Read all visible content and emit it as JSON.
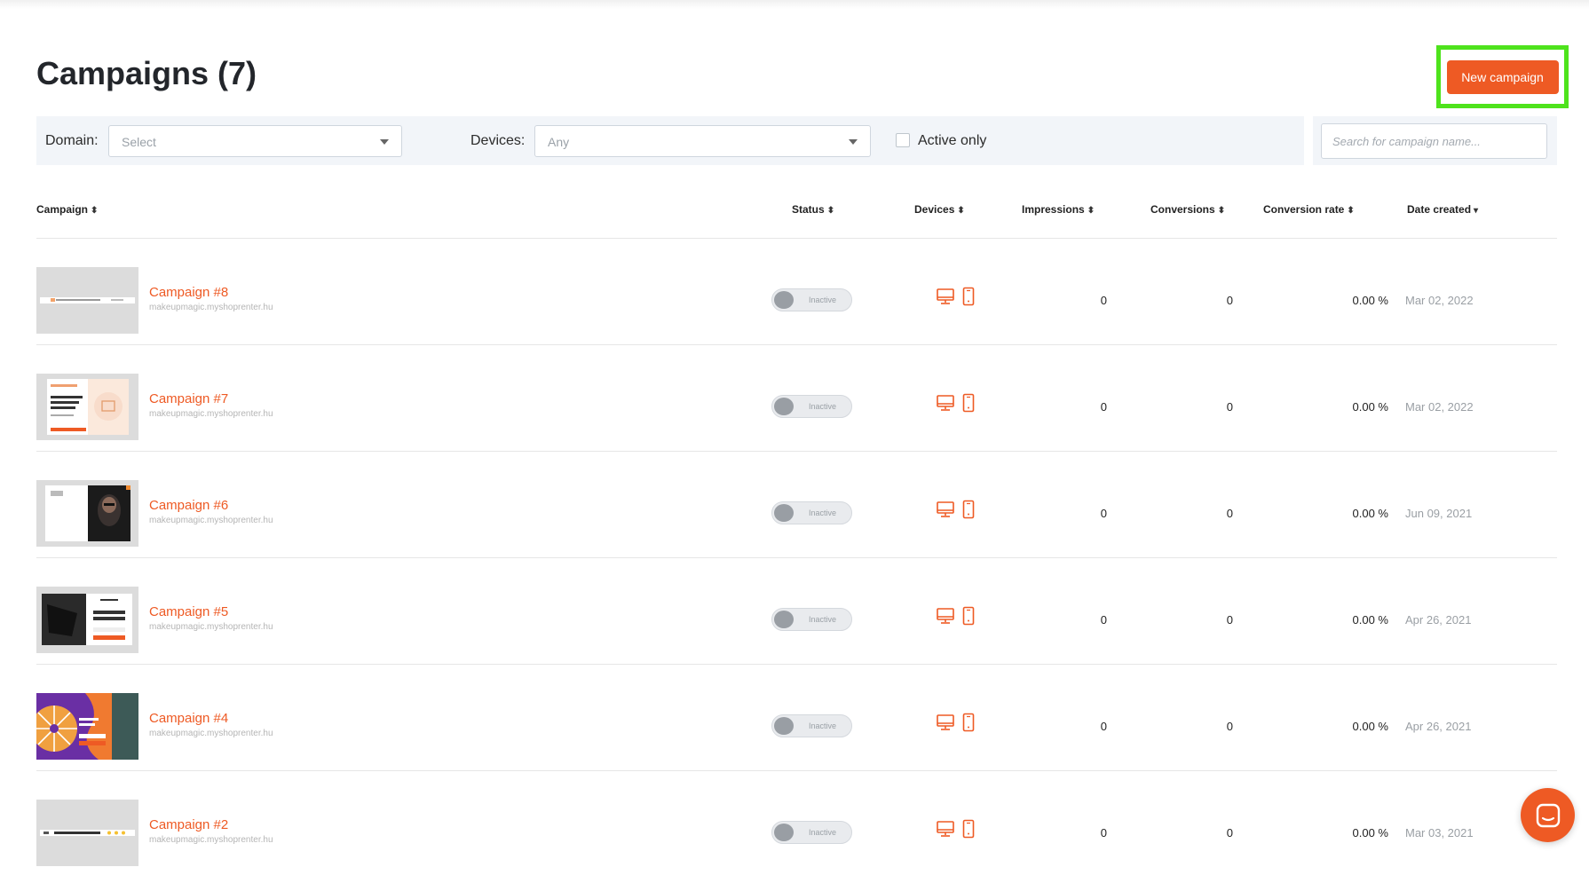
{
  "page": {
    "title": "Campaigns (7)",
    "new_campaign_label": "New campaign",
    "accent_color": "#ee5a24"
  },
  "filters": {
    "domain_label": "Domain:",
    "domain_value": "Select",
    "devices_label": "Devices:",
    "devices_value": "Any",
    "active_only_label": "Active only",
    "active_only_checked": false,
    "search_placeholder": "Search for campaign name..."
  },
  "table": {
    "columns": [
      "Campaign",
      "Status",
      "Devices",
      "Impressions",
      "Conversions",
      "Conversion rate",
      "Date created"
    ],
    "sorted_column": "Date created",
    "rows": [
      {
        "name": "Campaign #8",
        "domain": "makeupmagic.myshoprenter.hu",
        "status": "Inactive",
        "devices": [
          "desktop-icon",
          "mobile-icon"
        ],
        "impressions": "0",
        "conversions": "0",
        "conversion_rate": "0.00 %",
        "date": "Mar 02, 2022",
        "thumb": "bar"
      },
      {
        "name": "Campaign #7",
        "domain": "makeupmagic.myshoprenter.hu",
        "status": "Inactive",
        "devices": [
          "desktop-icon",
          "mobile-icon"
        ],
        "impressions": "0",
        "conversions": "0",
        "conversion_rate": "0.00 %",
        "date": "Mar 02, 2022",
        "thumb": "popup-peach"
      },
      {
        "name": "Campaign #6",
        "domain": "makeupmagic.myshoprenter.hu",
        "status": "Inactive",
        "devices": [
          "desktop-icon",
          "mobile-icon"
        ],
        "impressions": "0",
        "conversions": "0",
        "conversion_rate": "0.00 %",
        "date": "Jun 09, 2021",
        "thumb": "popup-photo"
      },
      {
        "name": "Campaign #5",
        "domain": "makeupmagic.myshoprenter.hu",
        "status": "Inactive",
        "devices": [
          "desktop-icon",
          "mobile-icon"
        ],
        "impressions": "0",
        "conversions": "0",
        "conversion_rate": "0.00 %",
        "date": "Apr 26, 2021",
        "thumb": "popup-dark"
      },
      {
        "name": "Campaign #4",
        "domain": "makeupmagic.myshoprenter.hu",
        "status": "Inactive",
        "devices": [
          "desktop-icon",
          "mobile-icon"
        ],
        "impressions": "0",
        "conversions": "0",
        "conversion_rate": "0.00 %",
        "date": "Apr 26, 2021",
        "thumb": "wheel"
      },
      {
        "name": "Campaign #2",
        "domain": "makeupmagic.myshoprenter.hu",
        "status": "Inactive",
        "devices": [
          "desktop-icon",
          "mobile-icon"
        ],
        "impressions": "0",
        "conversions": "0",
        "conversion_rate": "0.00 %",
        "date": "Mar 03, 2021",
        "thumb": "bar-dots"
      }
    ]
  },
  "chat": {
    "icon": "chat-icon"
  }
}
